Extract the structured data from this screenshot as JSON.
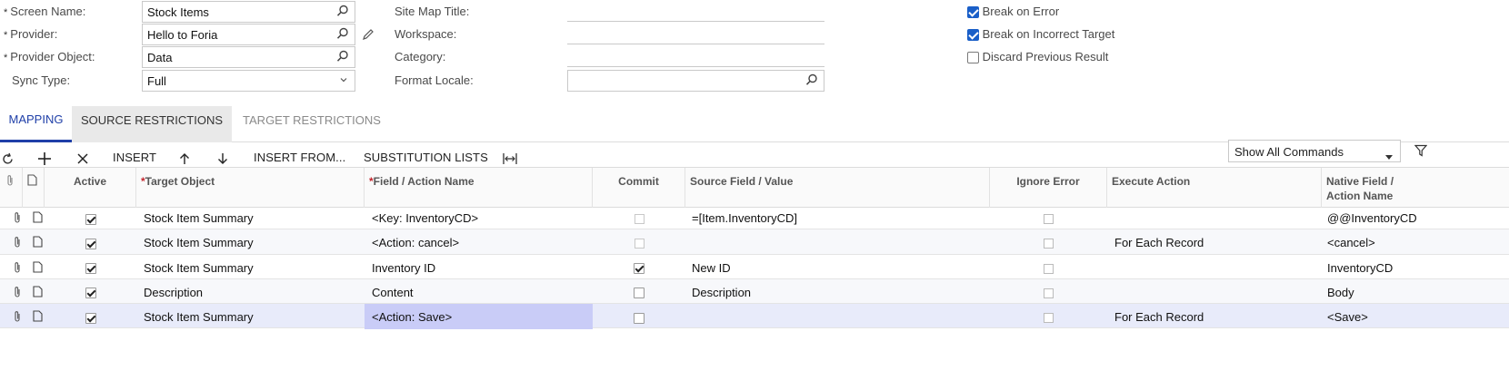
{
  "form": {
    "screen_name_label": "Screen Name:",
    "screen_name_value": "Stock Items",
    "provider_label": "Provider:",
    "provider_value": "Hello to Foria",
    "provider_object_label": "Provider Object:",
    "provider_object_value": "Data",
    "sync_type_label": "Sync Type:",
    "sync_type_value": "Full",
    "site_map_title_label": "Site Map Title:",
    "workspace_label": "Workspace:",
    "category_label": "Category:",
    "format_locale_label": "Format Locale:",
    "required_mark": "*",
    "break_on_error_label": "Break on Error",
    "break_on_error": true,
    "break_on_target_label": "Break on Incorrect Target",
    "break_on_target": true,
    "discard_label": "Discard Previous Result",
    "discard": false
  },
  "tabs": {
    "mapping": "MAPPING",
    "source": "SOURCE RESTRICTIONS",
    "target": "TARGET RESTRICTIONS"
  },
  "toolbar": {
    "insert": "INSERT",
    "insert_from": "INSERT FROM...",
    "substitution": "SUBSTITUTION LISTS",
    "show_commands": "Show All Commands"
  },
  "grid": {
    "headers": {
      "active": "Active",
      "target_object": "Target Object",
      "field_action": "Field / Action Name",
      "commit": "Commit",
      "source_field": "Source Field / Value",
      "ignore_error": "Ignore Error",
      "execute_action": "Execute Action",
      "native_field_1": "Native Field /",
      "native_field_2": "Action Name"
    },
    "rows": [
      {
        "active": true,
        "target_object": "Stock Item Summary",
        "field": "<Key: InventoryCD>",
        "commit": false,
        "commit_disabled": true,
        "source": "=[Item.InventoryCD]",
        "ignore": false,
        "execute": "",
        "native": "@@InventoryCD"
      },
      {
        "active": true,
        "target_object": "Stock Item Summary",
        "field": "<Action: cancel>",
        "commit": false,
        "commit_disabled": true,
        "source": "",
        "ignore": false,
        "execute": "For Each Record",
        "native": "<cancel>"
      },
      {
        "active": true,
        "target_object": "Stock Item Summary",
        "field": "Inventory ID",
        "commit": true,
        "commit_disabled": false,
        "source": "New ID",
        "ignore": false,
        "execute": "",
        "native": "InventoryCD"
      },
      {
        "active": true,
        "target_object": "Description",
        "field": "Content",
        "commit": false,
        "commit_disabled": false,
        "source": "Description",
        "ignore": false,
        "execute": "",
        "native": "Body"
      },
      {
        "active": true,
        "target_object": "Stock Item Summary",
        "field": "<Action: Save>",
        "commit": false,
        "commit_disabled": false,
        "source": "",
        "ignore": false,
        "execute": "For Each Record",
        "native": "<Save>"
      }
    ]
  },
  "colors": {
    "accent": "#1f3fa8",
    "checkbox_blue": "#1a5fc8",
    "selected_row": "#e8ebfa",
    "selected_cell": "#c9ccf7"
  }
}
